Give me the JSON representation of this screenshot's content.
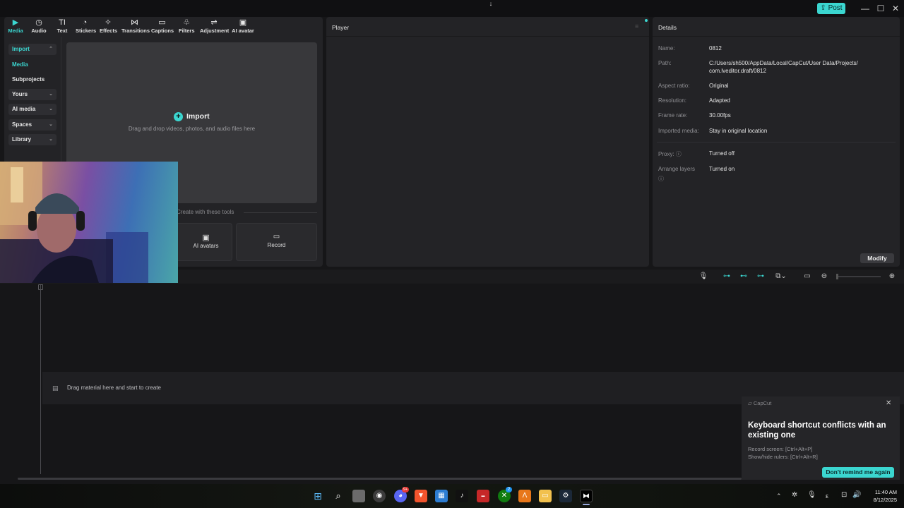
{
  "window": {
    "post_label": "Post",
    "minimize": "—",
    "maximize": "☐",
    "close": "✕"
  },
  "toolbar": {
    "tabs": [
      {
        "label": "Media",
        "icon": "media-icon",
        "glyph": "▶"
      },
      {
        "label": "Audio",
        "icon": "audio-icon",
        "glyph": "◷"
      },
      {
        "label": "Text",
        "icon": "text-icon",
        "glyph": "TI"
      },
      {
        "label": "Stickers",
        "icon": "stickers-icon",
        "glyph": "◔"
      },
      {
        "label": "Effects",
        "icon": "effects-icon",
        "glyph": "✧"
      },
      {
        "label": "Transitions",
        "icon": "transitions-icon",
        "glyph": "⋈"
      },
      {
        "label": "Captions",
        "icon": "captions-icon",
        "glyph": "▭"
      },
      {
        "label": "Filters",
        "icon": "filters-icon",
        "glyph": "♧"
      },
      {
        "label": "Adjustment",
        "icon": "adjustment-icon",
        "glyph": "⇌"
      },
      {
        "label": "AI avatar",
        "icon": "ai-avatar-icon",
        "glyph": "▣"
      }
    ]
  },
  "sidebar": {
    "items": [
      {
        "label": "Import",
        "active": true
      },
      {
        "label": "Media"
      },
      {
        "label": "Subprojects"
      },
      {
        "label": "Yours"
      },
      {
        "label": "AI media"
      },
      {
        "label": "Spaces"
      },
      {
        "label": "Library"
      }
    ]
  },
  "import_zone": {
    "title": "Import",
    "hint": "Drag and drop videos, photos, and audio files here"
  },
  "tools": {
    "heading": "Create with these tools",
    "ai_avatars": "AI avatars",
    "record": "Record"
  },
  "player": {
    "title": "Player"
  },
  "details": {
    "title": "Details",
    "rows": [
      {
        "label": "Name:",
        "value": "0812"
      },
      {
        "label": "Path:",
        "value": "C:/Users/sh500/AppData/Local/CapCut/User Data/Projects/",
        "value2": "com.lveditor.draft/0812"
      },
      {
        "label": "Aspect ratio:",
        "value": "Original"
      },
      {
        "label": "Resolution:",
        "value": "Adapted"
      },
      {
        "label": "Frame rate:",
        "value": "30.00fps"
      },
      {
        "label": "Imported media:",
        "value": "Stay in original location"
      },
      {
        "label": "Proxy:",
        "value": "Turned off"
      },
      {
        "label": "Arrange layers",
        "value": "Turned on"
      }
    ],
    "modify_label": "Modify"
  },
  "timeline": {
    "drop_hint": "Drag material here and start to create"
  },
  "toast": {
    "app": "CapCut",
    "title": "Keyboard shortcut conflicts with an existing one",
    "line1": "Record screen: [Ctrl+Alt+P]",
    "line2": "Show/hide rulers: [Ctrl+Alt+R]",
    "button": "Don't remind me again"
  },
  "taskbar": {
    "time": "11:40 AM",
    "date": "8/12/2025",
    "lang": "ε",
    "discord_badge": "9+",
    "xbox_badge": "2"
  },
  "colors": {
    "accent": "#3bd6d0",
    "panel": "#232326",
    "background": "#161618"
  }
}
